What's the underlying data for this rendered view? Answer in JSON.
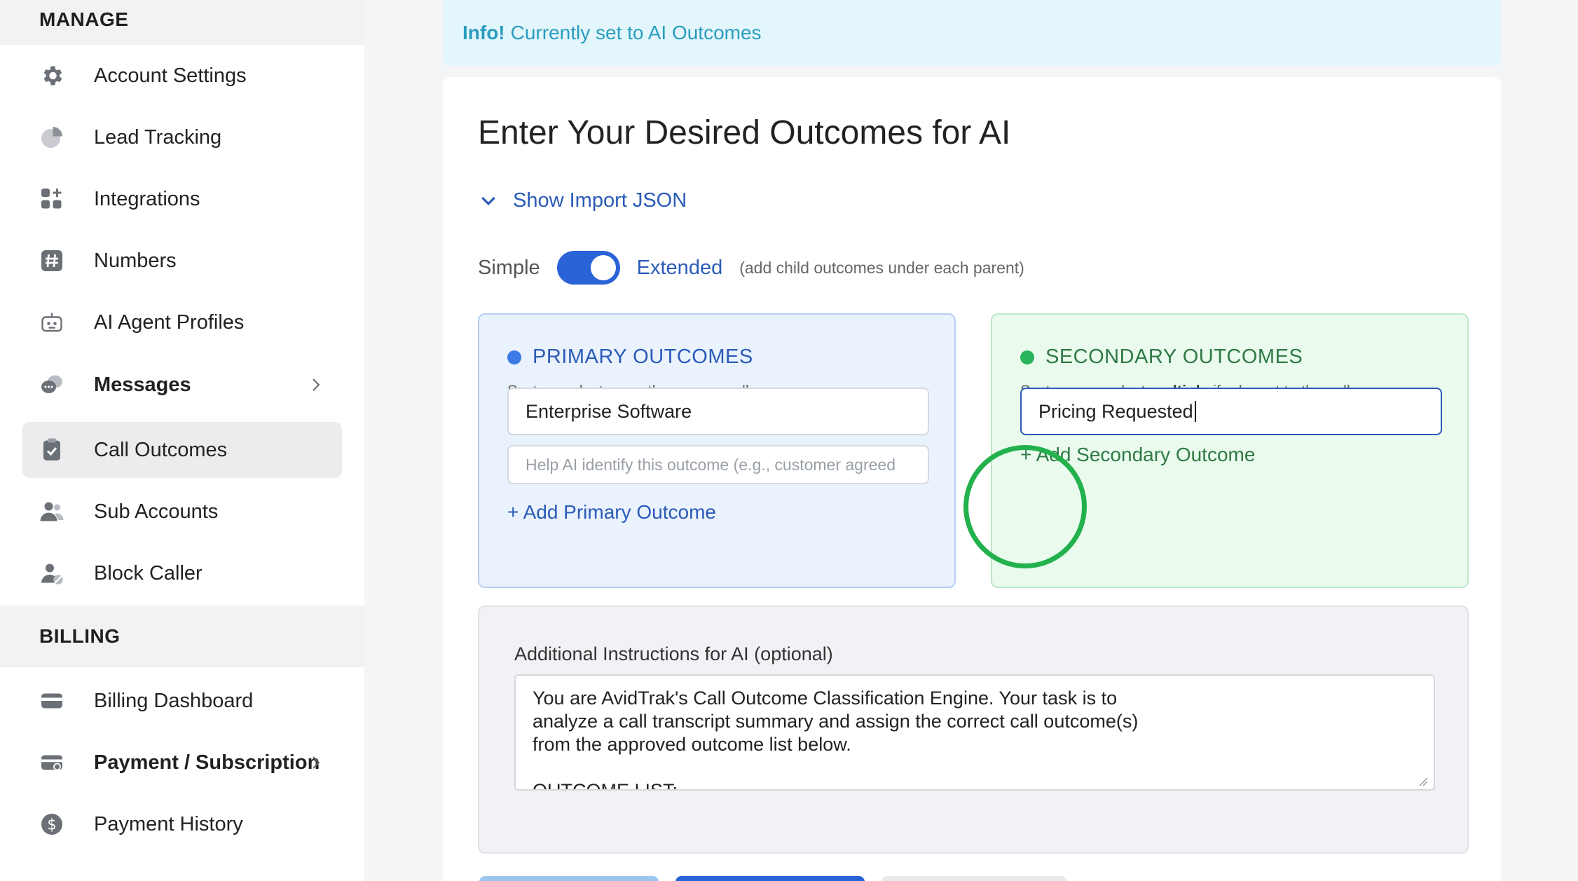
{
  "sidebar": {
    "manage_heading": "MANAGE",
    "billing_heading": "BILLING",
    "items": [
      {
        "label": "Account Settings",
        "icon": "gear-icon"
      },
      {
        "label": "Lead Tracking",
        "icon": "pie-chart-icon"
      },
      {
        "label": "Integrations",
        "icon": "apps-plus-icon"
      },
      {
        "label": "Numbers",
        "icon": "hash-icon"
      },
      {
        "label": "AI Agent Profiles",
        "icon": "robot-icon"
      },
      {
        "label": "Messages",
        "icon": "chat-bubbles-icon"
      },
      {
        "label": "Call Outcomes",
        "icon": "clipboard-check-icon"
      },
      {
        "label": "Sub Accounts",
        "icon": "users-icon"
      },
      {
        "label": "Block Caller",
        "icon": "user-block-icon"
      }
    ],
    "billing_items": [
      {
        "label": "Billing Dashboard",
        "icon": "credit-card-icon"
      },
      {
        "label": "Payment / Subscription",
        "icon": "card-refresh-icon"
      },
      {
        "label": "Payment History",
        "icon": "dollar-circle-icon"
      }
    ]
  },
  "info": {
    "prefix": "Info!",
    "message": "Currently set to AI Outcomes"
  },
  "main": {
    "title": "Enter Your Desired Outcomes for AI",
    "import_toggle": "Show Import JSON",
    "mode": {
      "simple": "Simple",
      "extended": "Extended",
      "hint": "(add child outcomes under each parent)",
      "extended_on": true
    },
    "primary": {
      "heading": "PRIMARY OUTCOMES",
      "sub_pre": "System selects exactly",
      "sub_bold": "one",
      "sub_post": "per call",
      "name_value": "Enterprise Software",
      "desc_placeholder": "Help AI identify this outcome (e.g., customer agreed",
      "add_label": "+ Add Primary Outcome"
    },
    "secondary": {
      "heading": "SECONDARY OUTCOMES",
      "sub_pre": "System can select",
      "sub_bold": "multiple",
      "sub_post": "if relevant to the call",
      "name_value": "Pricing Requested",
      "add_label": "+ Add Secondary Outcome"
    },
    "instructions": {
      "label": "Additional Instructions for AI (optional)",
      "text": "You are AvidTrak's Call Outcome Classification Engine. Your task is to\nanalyze a call transcript summary and assign the correct call outcome(s)\nfrom the approved outcome list below.\n\nOUTCOME LIST:"
    }
  },
  "colors": {
    "accent_blue": "#2a63d8",
    "accent_green": "#22b14c",
    "info_bg": "#e3f6fb"
  }
}
